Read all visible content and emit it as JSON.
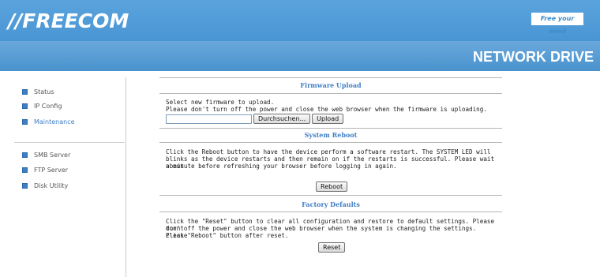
{
  "header": {
    "logo": "//FREECOM",
    "tagline": "Free your mind",
    "product": "NETWORK DRIVE"
  },
  "sidebar": {
    "group1": [
      {
        "label": "Status"
      },
      {
        "label": "IP Config"
      },
      {
        "label": "Maintenance",
        "active": true
      }
    ],
    "group2": [
      {
        "label": "SMB Server"
      },
      {
        "label": "FTP Server"
      },
      {
        "label": "Disk Utility"
      }
    ]
  },
  "firmware": {
    "title": "Firmware Upload",
    "line1": "Select new firmware to upload.",
    "line2": "Please don't turn off the power and close the web browser when the firmware is uploading.",
    "file_value": "",
    "browse_label": "Durchsuchen...",
    "upload_label": "Upload"
  },
  "reboot": {
    "title": "System Reboot",
    "line1": "Click the Reboot button to have the device perform a software restart. The SYSTEM LED will",
    "line2": "blinks as the device restarts and then remain on if the restarts is successful. Please wait about",
    "line3": "a minute before refreshing your browser before logging in again.",
    "button_label": "Reboot"
  },
  "factory": {
    "title": "Factory Defaults",
    "line1": "Click the \"Reset\" button to clear all configuration and restore to default settings. Please don't",
    "line2": "turn off the power and close the web browser when the system is changing the settings. Please",
    "line3": "click \"Reboot\" button after reset.",
    "button_label": "Reset"
  },
  "colors": {
    "header_blue": "#4a96d4",
    "accent": "#3f7ec6"
  }
}
